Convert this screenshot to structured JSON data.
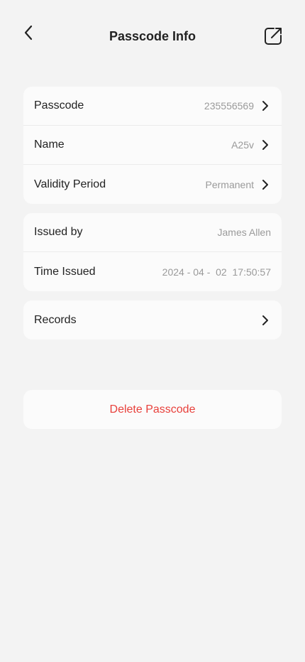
{
  "header": {
    "title": "Passcode Info"
  },
  "details": [
    {
      "label": "Passcode",
      "value": "235556569"
    },
    {
      "label": "Name",
      "value": "A25v"
    },
    {
      "label": "Validity Period",
      "value": "Permanent"
    }
  ],
  "issue": [
    {
      "label": "Issued by",
      "value": "James Allen"
    },
    {
      "label": "Time Issued",
      "value": "2024 - 04 -  02  17:50:57"
    }
  ],
  "records": {
    "label": "Records"
  },
  "delete": {
    "label": "Delete Passcode",
    "color": "#e8403b"
  },
  "icons": {
    "back": "chevron-left-icon",
    "share": "edit-share-icon",
    "row": "chevron-right-icon"
  }
}
